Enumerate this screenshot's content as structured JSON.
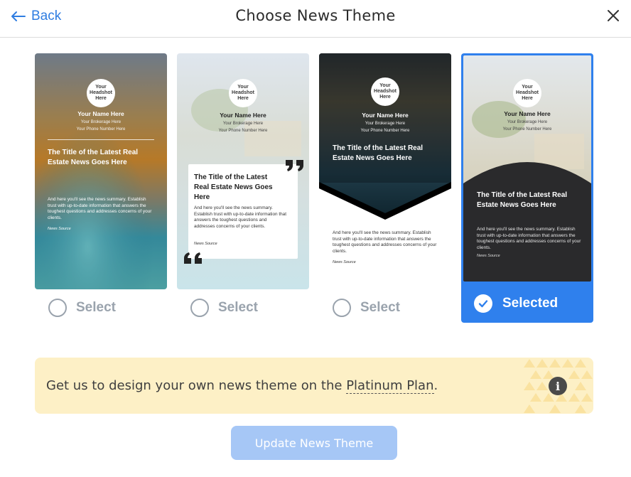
{
  "header": {
    "back_label": "Back",
    "title": "Choose News Theme"
  },
  "colors": {
    "accent": "#2f80ed",
    "banner_bg": "#fdf0c6",
    "button_disabled": "#a6c7f6"
  },
  "template_text": {
    "headshot": "Your Headshot Here",
    "name": "Your Name Here",
    "brokerage": "Your Brokerage Here",
    "phone": "Your Phone Number Here",
    "headline": "The Title of the Latest Real Estate News Goes Here",
    "summary": "And here you'll see the news summary. Establish trust with up-to-date information that answers the toughest questions and addresses concerns of your clients.",
    "source": "News Source"
  },
  "themes": [
    {
      "select_label": "Select",
      "selected": false
    },
    {
      "select_label": "Select",
      "selected": false
    },
    {
      "select_label": "Select",
      "selected": false
    },
    {
      "select_label": "Selected",
      "selected": true
    }
  ],
  "banner": {
    "text_before": "Get us to design your own news theme on the ",
    "link_text": "Platinum Plan",
    "text_after": ".",
    "icon": "info-icon"
  },
  "footer": {
    "update_button_label": "Update News Theme"
  }
}
